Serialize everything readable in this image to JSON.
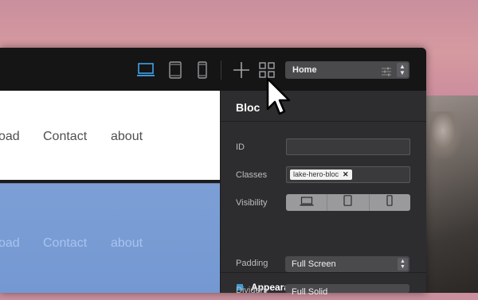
{
  "toolbar": {
    "devices": [
      "laptop-icon",
      "tablet-icon",
      "phone-icon"
    ],
    "active_device": "laptop",
    "accent_color": "#3fa3e8",
    "tools": [
      "add-icon",
      "grid-icon"
    ],
    "page_select": {
      "value": "Home"
    }
  },
  "canvas": {
    "top_nav": [
      {
        "label": "oad"
      },
      {
        "label": "Contact"
      },
      {
        "label": "about"
      }
    ],
    "hero_nav": [
      {
        "label": "oad"
      },
      {
        "label": "Contact"
      },
      {
        "label": "about"
      }
    ],
    "hero_color": "#7a9cd5"
  },
  "panel": {
    "title": "Bloc",
    "id_label": "ID",
    "id_value": "",
    "classes_label": "Classes",
    "class_tag": "lake-hero-bloc",
    "class_tag_remove": "✕",
    "visibility_label": "Visibility",
    "visibility_options": [
      "laptop-icon",
      "tablet-icon",
      "phone-icon"
    ],
    "appearance_title": "Appearance",
    "appearance_color": "#3e9ad8",
    "padding_label": "Padding",
    "padding_value": "Full Screen",
    "dividers_label": "Dividers",
    "dividers_value": "Full Solid"
  }
}
